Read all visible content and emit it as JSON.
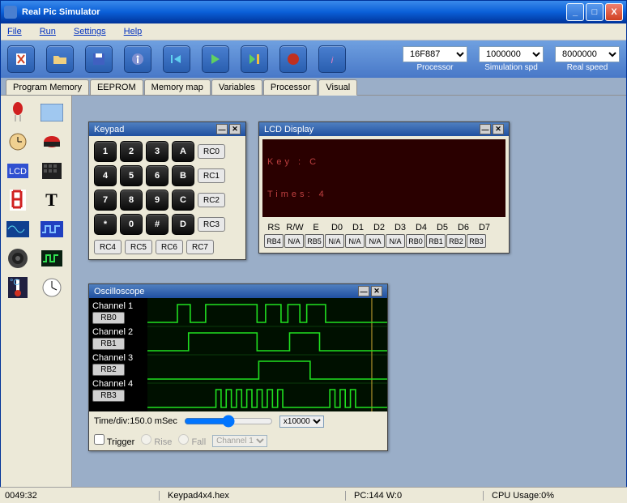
{
  "window": {
    "title": "Real Pic Simulator"
  },
  "menu": {
    "file": "File",
    "run": "Run",
    "settings": "Settings",
    "help": "Help"
  },
  "toolbar": {
    "processor_label": "Processor",
    "processor_value": "16F887",
    "sim_label": "Simulation spd",
    "sim_value": "1000000",
    "real_label": "Real speed",
    "real_value": "8000000"
  },
  "tabs": {
    "program": "Program Memory",
    "eeprom": "EEPROM",
    "memmap": "Memory map",
    "variables": "Variables",
    "processor": "Processor",
    "visual": "Visual"
  },
  "keypad": {
    "title": "Keypad",
    "keys": [
      "1",
      "2",
      "3",
      "A",
      "4",
      "5",
      "6",
      "B",
      "7",
      "8",
      "9",
      "C",
      "*",
      "0",
      "#",
      "D"
    ],
    "rc_side": [
      "RC0",
      "RC1",
      "RC2",
      "RC3"
    ],
    "rc_bottom": [
      "RC4",
      "RC5",
      "RC6",
      "RC7"
    ]
  },
  "lcd": {
    "title": "LCD Display",
    "line1": "Key   :   C",
    "line2": "Times:          4",
    "pin_labels": [
      "RS",
      "R/W",
      "E",
      "D0",
      "D1",
      "D2",
      "D3",
      "D4",
      "D5",
      "D6",
      "D7"
    ],
    "pin_values": [
      "RB4",
      "N/A",
      "RB5",
      "N/A",
      "N/A",
      "N/A",
      "N/A",
      "RB0",
      "RB1",
      "RB2",
      "RB3"
    ]
  },
  "scope": {
    "title": "Oscilloscope",
    "channels": [
      {
        "label": "Channel 1",
        "btn": "RB0"
      },
      {
        "label": "Channel 2",
        "btn": "RB1"
      },
      {
        "label": "Channel 3",
        "btn": "RB2"
      },
      {
        "label": "Channel 4",
        "btn": "RB3"
      }
    ],
    "timediv": "Time/div:150.0 mSec",
    "trigger": "Trigger",
    "rise": "Rise",
    "fall": "Fall",
    "trigch": "Channel 1",
    "mult": "x10000"
  },
  "status": {
    "time": "0049:32",
    "file": "Keypad4x4.hex",
    "pc": "PC:144 W:0",
    "cpu": "CPU Usage:0%"
  }
}
